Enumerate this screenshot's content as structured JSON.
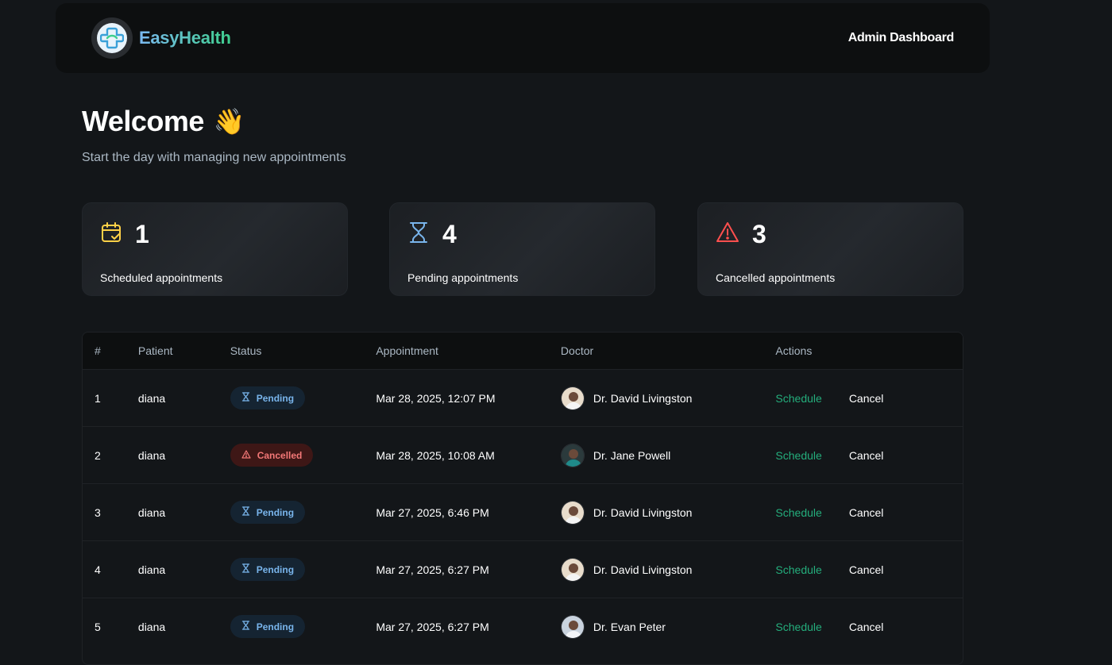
{
  "header": {
    "brand": "EasyHealth",
    "title": "Admin Dashboard"
  },
  "welcome": {
    "title": "Welcome",
    "emoji": "👋",
    "subtitle": "Start the day with managing new appointments"
  },
  "stats": [
    {
      "count": "1",
      "label": "Scheduled appointments",
      "icon": "calendar-check-icon",
      "color": "#ffd147"
    },
    {
      "count": "4",
      "label": "Pending appointments",
      "icon": "hourglass-icon",
      "color": "#79b5ec"
    },
    {
      "count": "3",
      "label": "Cancelled appointments",
      "icon": "warning-icon",
      "color": "#ff4f4e"
    }
  ],
  "table": {
    "headers": [
      "#",
      "Patient",
      "Status",
      "Appointment",
      "Doctor",
      "Actions"
    ],
    "rows": [
      {
        "num": "1",
        "patient": "diana",
        "status": "Pending",
        "status_type": "pending",
        "date": "Mar 28, 2025, 12:07 PM",
        "doctor": "Dr. David Livingston",
        "schedule": "Schedule",
        "cancel": "Cancel"
      },
      {
        "num": "2",
        "patient": "diana",
        "status": "Cancelled",
        "status_type": "cancelled",
        "date": "Mar 28, 2025, 10:08 AM",
        "doctor": "Dr. Jane Powell",
        "schedule": "Schedule",
        "cancel": "Cancel"
      },
      {
        "num": "3",
        "patient": "diana",
        "status": "Pending",
        "status_type": "pending",
        "date": "Mar 27, 2025, 6:46 PM",
        "doctor": "Dr. David Livingston",
        "schedule": "Schedule",
        "cancel": "Cancel"
      },
      {
        "num": "4",
        "patient": "diana",
        "status": "Pending",
        "status_type": "pending",
        "date": "Mar 27, 2025, 6:27 PM",
        "doctor": "Dr. David Livingston",
        "schedule": "Schedule",
        "cancel": "Cancel"
      },
      {
        "num": "5",
        "patient": "diana",
        "status": "Pending",
        "status_type": "pending",
        "date": "Mar 27, 2025, 6:27 PM",
        "doctor": "Dr. Evan Peter",
        "schedule": "Schedule",
        "cancel": "Cancel"
      }
    ]
  },
  "colors": {
    "background": "#131619",
    "accent_green": "#24ae7c",
    "pending_blue": "#79b5ec",
    "cancelled_red": "#f37877"
  }
}
